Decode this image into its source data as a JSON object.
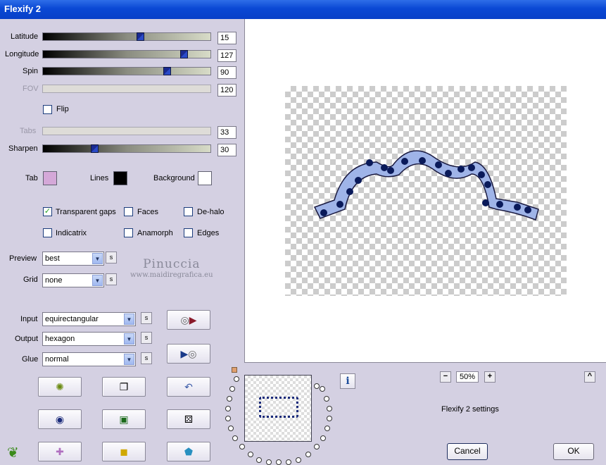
{
  "window": {
    "title": "Flexify 2"
  },
  "sliders": [
    {
      "label": "Latitude",
      "value": "15",
      "position": 0.57,
      "enabled": true
    },
    {
      "label": "Longitude",
      "value": "127",
      "position": 0.83,
      "enabled": true
    },
    {
      "label": "Spin",
      "value": "90",
      "position": 0.73,
      "enabled": true
    },
    {
      "label": "FOV",
      "value": "120",
      "position": null,
      "enabled": false
    },
    {
      "label": "Tabs",
      "value": "33",
      "position": null,
      "enabled": false
    },
    {
      "label": "Sharpen",
      "value": "30",
      "position": 0.28,
      "enabled": true
    }
  ],
  "flip": {
    "label": "Flip",
    "checked": false
  },
  "colors": {
    "tab_label": "Tab",
    "tab_color": "#d4a8d8",
    "lines_label": "Lines",
    "lines_color": "#000000",
    "background_label": "Background",
    "background_color": "#ffffff"
  },
  "checkboxes": [
    {
      "label": "Transparent gaps",
      "checked": true
    },
    {
      "label": "Faces",
      "checked": false
    },
    {
      "label": "De-halo",
      "checked": false
    },
    {
      "label": "Indicatrix",
      "checked": false
    },
    {
      "label": "Anamorph",
      "checked": false
    },
    {
      "label": "Edges",
      "checked": false
    }
  ],
  "preview": {
    "label": "Preview",
    "value": "best"
  },
  "grid": {
    "label": "Grid",
    "value": "none"
  },
  "watermark": {
    "line1": "Pinuccia",
    "line2": "www.maidiregrafica.eu"
  },
  "input": {
    "label": "Input",
    "value": "equirectangular"
  },
  "output": {
    "label": "Output",
    "value": "hexagon"
  },
  "glue": {
    "label": "Glue",
    "value": "normal"
  },
  "s_button": "s",
  "zoom": {
    "minus": "−",
    "value": "50%",
    "plus": "+"
  },
  "collapse": "^",
  "info_icon": "i",
  "status": "Flexify 2 settings",
  "buttons": {
    "cancel": "Cancel",
    "ok": "OK"
  }
}
